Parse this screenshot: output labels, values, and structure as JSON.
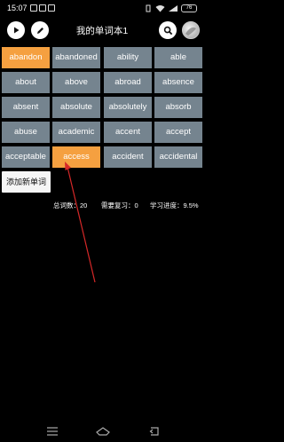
{
  "status_bar": {
    "time": "15:07",
    "battery": "76"
  },
  "toolbar": {
    "title": "我的单词本1"
  },
  "words": [
    {
      "label": "abandon",
      "state": "active"
    },
    {
      "label": "abandoned",
      "state": "normal"
    },
    {
      "label": "ability",
      "state": "normal"
    },
    {
      "label": "able",
      "state": "normal"
    },
    {
      "label": "about",
      "state": "normal"
    },
    {
      "label": "above",
      "state": "normal"
    },
    {
      "label": "abroad",
      "state": "normal"
    },
    {
      "label": "absence",
      "state": "normal"
    },
    {
      "label": "absent",
      "state": "normal"
    },
    {
      "label": "absolute",
      "state": "normal"
    },
    {
      "label": "absolutely",
      "state": "normal"
    },
    {
      "label": "absorb",
      "state": "normal"
    },
    {
      "label": "abuse",
      "state": "normal"
    },
    {
      "label": "academic",
      "state": "normal"
    },
    {
      "label": "accent",
      "state": "normal"
    },
    {
      "label": "accept",
      "state": "normal"
    },
    {
      "label": "acceptable",
      "state": "normal"
    },
    {
      "label": "access",
      "state": "active"
    },
    {
      "label": "accident",
      "state": "normal"
    },
    {
      "label": "accidental",
      "state": "normal"
    }
  ],
  "add_button": {
    "label": "添加新单词"
  },
  "stats": {
    "total": "总词数：20",
    "review": "需要复习：0",
    "progress": "学习进度：9.5%"
  },
  "colors": {
    "tile": "#75848f",
    "tile_active": "#f5a040",
    "annotation_arrow": "#d62828"
  }
}
